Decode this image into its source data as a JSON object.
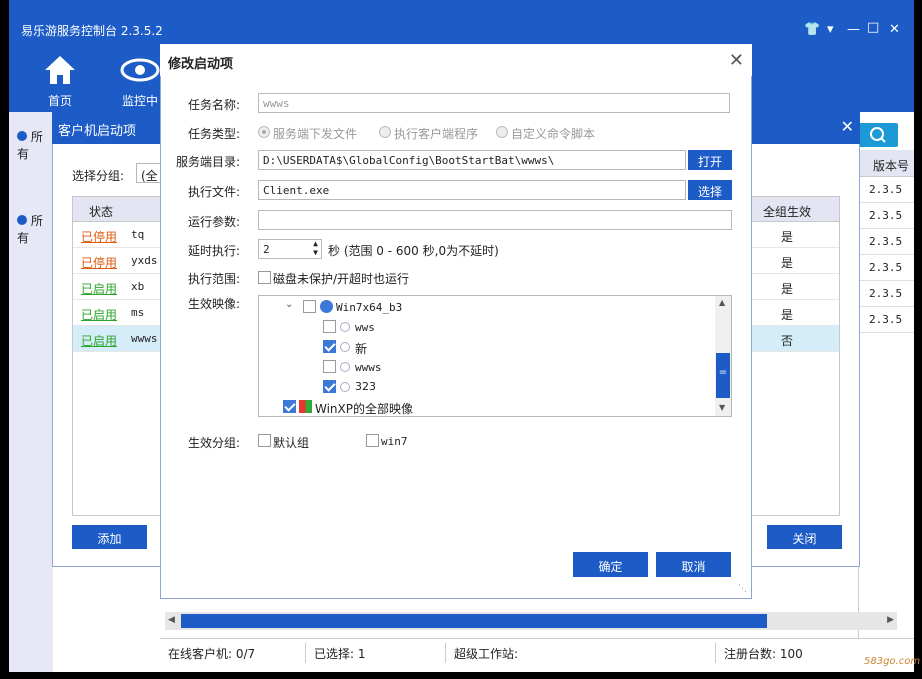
{
  "app": {
    "title": "易乐游服务控制台 2.3.5.2",
    "nav": [
      {
        "label": "首页",
        "icon": "home-icon"
      },
      {
        "label": "监控中",
        "icon": "eye-icon"
      }
    ]
  },
  "left_panel": {
    "item1": "所有",
    "item2": "所有"
  },
  "right_grid": {
    "header": "版本号",
    "rows": [
      "2.3.5",
      "2.3.5",
      "2.3.5",
      "2.3.5",
      "2.3.5",
      "2.3.5"
    ]
  },
  "dialog1": {
    "title": "客户机启动项",
    "group_label": "选择分组:",
    "group_value": "(全",
    "columns": {
      "status": "状态",
      "all_group": "全组生效"
    },
    "rows": [
      {
        "status": "已停用",
        "kind": "off",
        "name": "tq",
        "all": "是"
      },
      {
        "status": "已停用",
        "kind": "off",
        "name": "yxds",
        "all": "是"
      },
      {
        "status": "已启用",
        "kind": "on",
        "name": "xb",
        "all": "是"
      },
      {
        "status": "已启用",
        "kind": "on",
        "name": "ms",
        "all": "是"
      },
      {
        "status": "已启用",
        "kind": "on",
        "name": "wwws",
        "all": "否"
      }
    ],
    "add_btn": "添加",
    "close_btn": "关闭"
  },
  "dialog2": {
    "title": "修改启动项",
    "task_name_label": "任务名称:",
    "task_name_value": "wwws",
    "task_type_label": "任务类型:",
    "task_types": [
      "服务端下发文件",
      "执行客户端程序",
      "自定义命令脚本"
    ],
    "server_dir_label": "服务端目录:",
    "server_dir_value": "D:\\USERDATA$\\GlobalConfig\\BootStartBat\\wwws\\",
    "open_btn": "打开",
    "exec_file_label": "执行文件:",
    "exec_file_value": "Client.exe",
    "select_btn": "选择",
    "run_params_label": "运行参数:",
    "run_params_value": "",
    "delay_label": "延时执行:",
    "delay_value": "2",
    "delay_hint": "秒 (范围 0 - 600 秒,0为不延时)",
    "scope_label": "执行范围:",
    "scope_option": "磁盘未保护/开超时也运行",
    "images_label": "生效映像:",
    "tree": [
      {
        "label": "Win7x64_b3",
        "checked": false
      },
      {
        "label": "wws",
        "checked": false
      },
      {
        "label": "新",
        "checked": true
      },
      {
        "label": "wwws",
        "checked": false
      },
      {
        "label": "323",
        "checked": true
      },
      {
        "label": "WinXP的全部映像",
        "checked": true
      }
    ],
    "groups_label": "生效分组:",
    "groups": [
      {
        "label": "默认组",
        "checked": false
      },
      {
        "label": "win7",
        "checked": false
      }
    ],
    "ok_btn": "确定",
    "cancel_btn": "取消"
  },
  "status_bar": {
    "online": "在线客户机: 0/7",
    "selected": "已选择: 1",
    "super": "超级工作站:",
    "reg": "注册台数: 100"
  },
  "watermark": "583go.com"
}
